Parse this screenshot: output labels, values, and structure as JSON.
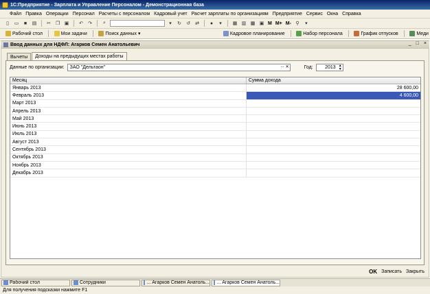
{
  "window": {
    "title": "1С:Предприятие - Зарплата и Управление Персоналом - Демонстрационная база"
  },
  "menu": {
    "items": [
      "Файл",
      "Правка",
      "Операции",
      "Персонал",
      "Расчеты с персоналом",
      "Кадровый учет",
      "Расчет зарплаты по организациям",
      "Предприятие",
      "Сервис",
      "Окна",
      "Справка"
    ]
  },
  "toolbar": {
    "m_label": "M",
    "m_plus_label": "M+",
    "m_minus_label": "M-"
  },
  "panel": {
    "items": [
      "Рабочий стол",
      "Мои задачи",
      "Поиск данных",
      "Кадровое планирование",
      "Набор персонала",
      "График отпусков",
      "Меди"
    ]
  },
  "form": {
    "title": "Ввод данных для НДФЛ: Агарков Семен Анатольевич",
    "window_buttons": [
      "_",
      "□",
      "×"
    ],
    "tabs": [
      "Вычеты",
      "Доходы на предыдущих местах работы"
    ],
    "org_label": "Данные по организации:",
    "org_value": "ЗАО \"Дельтаон\"",
    "year_label": "Год:",
    "year_value": "2013",
    "columns": [
      "Месяц",
      "Сумма дохода"
    ],
    "rows": [
      {
        "month": "Январь 2013",
        "amount": "28 600,00"
      },
      {
        "month": "Февраль 2013",
        "amount": "4 600,00"
      },
      {
        "month": "Март 2013",
        "amount": ""
      },
      {
        "month": "Апрель 2013",
        "amount": ""
      },
      {
        "month": "Май 2013",
        "amount": ""
      },
      {
        "month": "Июнь 2013",
        "amount": ""
      },
      {
        "month": "Июль 2013",
        "amount": ""
      },
      {
        "month": "Август 2013",
        "amount": ""
      },
      {
        "month": "Сентябрь 2013",
        "amount": ""
      },
      {
        "month": "Октябрь 2013",
        "amount": ""
      },
      {
        "month": "Ноябрь 2013",
        "amount": ""
      },
      {
        "month": "Декабрь 2013",
        "amount": ""
      }
    ],
    "selected_row": 1,
    "ok_label": "OK",
    "save_label": "Записать",
    "close_label": "Закрыть"
  },
  "taskbar": {
    "items": [
      "Рабочий стол",
      "Сотрудники",
      "... Агарков Семен Анатоль...",
      "... Агарков Семен Анатоль..."
    ]
  },
  "status": {
    "text": "Для получения подсказки нажмите F1"
  },
  "colors": {
    "title_bar": "#0a246a",
    "selection": "#3a58b6",
    "background": "#f3efe2"
  }
}
